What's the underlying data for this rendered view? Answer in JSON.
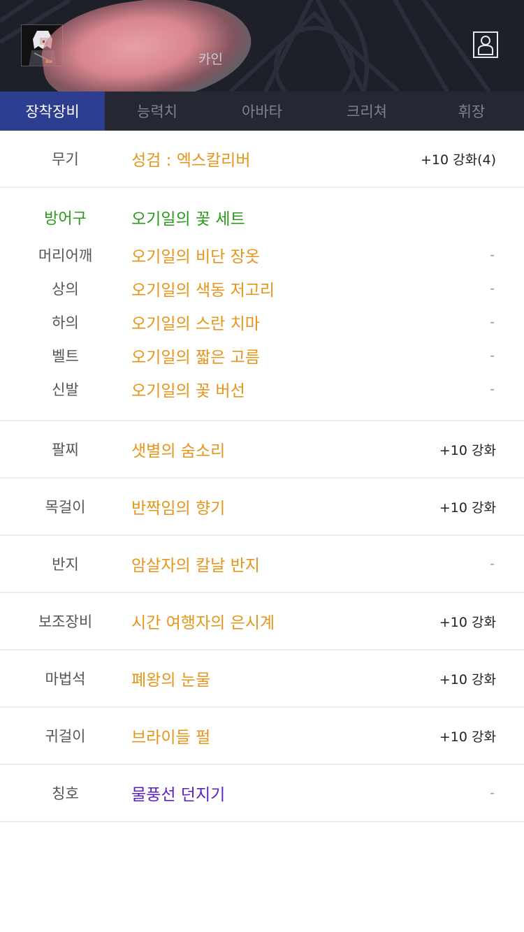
{
  "header": {
    "character_name": "카인",
    "profile_icon": "user-profile-icon"
  },
  "tabs": [
    {
      "label": "장착장비",
      "active": true
    },
    {
      "label": "능력치",
      "active": false
    },
    {
      "label": "아바타",
      "active": false
    },
    {
      "label": "크리쳐",
      "active": false
    },
    {
      "label": "휘장",
      "active": false
    }
  ],
  "equipment": {
    "weapon": {
      "slot": "무기",
      "name": "성검 : 엑스칼리버",
      "enhance": "+10 강화(4)"
    },
    "armor": {
      "slot": "방어구",
      "set_name": "오기일의 꽃 세트",
      "pieces": [
        {
          "slot": "머리어깨",
          "name": "오기일의 비단 장옷",
          "enhance": "-"
        },
        {
          "slot": "상의",
          "name": "오기일의 색동 저고리",
          "enhance": "-"
        },
        {
          "slot": "하의",
          "name": "오기일의 스란 치마",
          "enhance": "-"
        },
        {
          "slot": "벨트",
          "name": "오기일의 짧은 고름",
          "enhance": "-"
        },
        {
          "slot": "신발",
          "name": "오기일의 꽃 버선",
          "enhance": "-"
        }
      ]
    },
    "accessories": [
      {
        "slot": "팔찌",
        "name": "샛별의 숨소리",
        "enhance": "+10 강화"
      },
      {
        "slot": "목걸이",
        "name": "반짝임의 향기",
        "enhance": "+10 강화"
      },
      {
        "slot": "반지",
        "name": "암살자의 칼날 반지",
        "enhance": "-"
      },
      {
        "slot": "보조장비",
        "name": "시간 여행자의 은시계",
        "enhance": "+10 강화"
      },
      {
        "slot": "마법석",
        "name": "폐왕의 눈물",
        "enhance": "+10 강화"
      },
      {
        "slot": "귀걸이",
        "name": "브라이들 펄",
        "enhance": "+10 강화"
      }
    ],
    "title": {
      "slot": "칭호",
      "name": "물풍선 던지기",
      "enhance": "-"
    }
  },
  "colors": {
    "item_orange": "#e5951a",
    "set_green": "#2b9a1c",
    "title_purple": "#5a1fc4",
    "tab_active": "#2d3d8f",
    "tab_bar": "#252833",
    "header_bg": "#1e2029"
  }
}
